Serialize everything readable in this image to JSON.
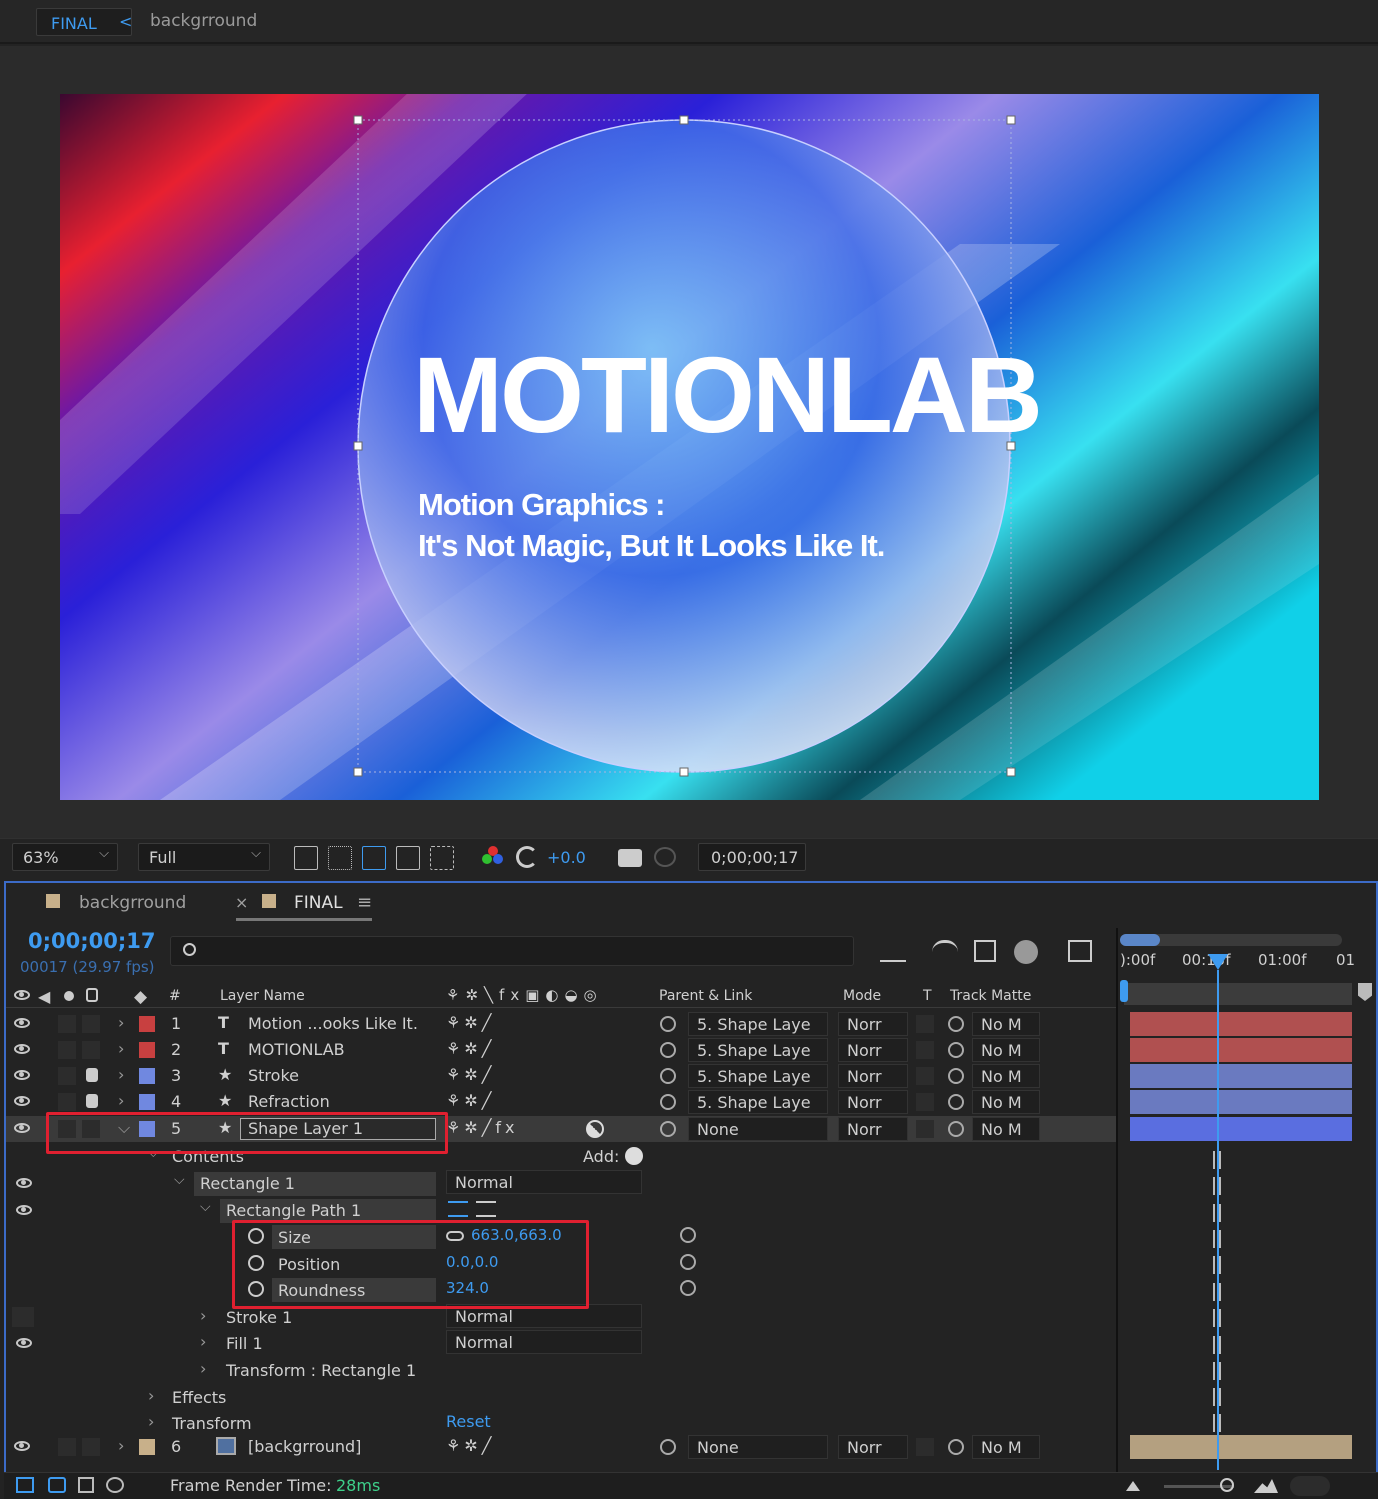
{
  "top_tabs": {
    "active": "FINAL",
    "arrow": "<",
    "breadcrumb": "backgrround"
  },
  "canvas": {
    "title": "MOTIONLAB",
    "subtitle_line1": "Motion Graphics :",
    "subtitle_line2": "It's Not Magic, But It Looks Like It."
  },
  "viewer_toolbar": {
    "zoom": "63%",
    "resolution": "Full",
    "exposure": "+0.0",
    "timecode": "0;00;00;17"
  },
  "panel_tabs": {
    "tab1": "backgrround",
    "close": "×",
    "tab2": "FINAL",
    "menu": "≡"
  },
  "timeline": {
    "timecode": "0;00;00;17",
    "frame_info": "00017 (29.97 fps)",
    "ruler": [
      "):00f",
      "00:15f",
      "01:00f",
      "01"
    ]
  },
  "columns": {
    "num": "#",
    "layer_name": "Layer Name",
    "parent": "Parent & Link",
    "mode": "Mode",
    "t": "T",
    "track_matte": "Track Matte"
  },
  "layers": [
    {
      "num": "1",
      "type": "T",
      "name": "Motion ...ooks Like It.",
      "parent": "5. Shape Laye",
      "mode": "Norr",
      "matte": "No M",
      "color": "#c84040"
    },
    {
      "num": "2",
      "type": "T",
      "name": "MOTIONLAB",
      "parent": "5. Shape Laye",
      "mode": "Norr",
      "matte": "No M",
      "color": "#c84040"
    },
    {
      "num": "3",
      "type": "★",
      "name": "Stroke",
      "parent": "5. Shape Laye",
      "mode": "Norr",
      "matte": "No M",
      "color": "#7088e0"
    },
    {
      "num": "4",
      "type": "★",
      "name": "Refraction",
      "parent": "5. Shape Laye",
      "mode": "Norr",
      "matte": "No M",
      "color": "#7088e0"
    },
    {
      "num": "5",
      "type": "★",
      "name": "Shape Layer 1",
      "parent": "None",
      "mode": "Norr",
      "matte": "No M",
      "color": "#7088e0"
    },
    {
      "num": "6",
      "type": "img",
      "name": "[backgrround]",
      "parent": "None",
      "mode": "Norr",
      "matte": "No M",
      "color": "#c8b08a"
    }
  ],
  "props": {
    "contents": "Contents",
    "add": "Add:",
    "rectangle": "Rectangle 1",
    "rectangle_mode": "Normal",
    "rect_path": "Rectangle Path 1",
    "size_label": "Size",
    "size_value": "663.0,663.0",
    "position_label": "Position",
    "position_value": "0.0,0.0",
    "roundness_label": "Roundness",
    "roundness_value": "324.0",
    "stroke": "Stroke 1",
    "stroke_mode": "Normal",
    "fill": "Fill 1",
    "fill_mode": "Normal",
    "transform_rect": "Transform : Rectangle 1",
    "effects": "Effects",
    "transform": "Transform",
    "reset": "Reset"
  },
  "status": {
    "label": "Frame Render Time:",
    "value": "28ms"
  },
  "colors": {
    "accent": "#3e9bf0",
    "highlight": "#e02030"
  }
}
